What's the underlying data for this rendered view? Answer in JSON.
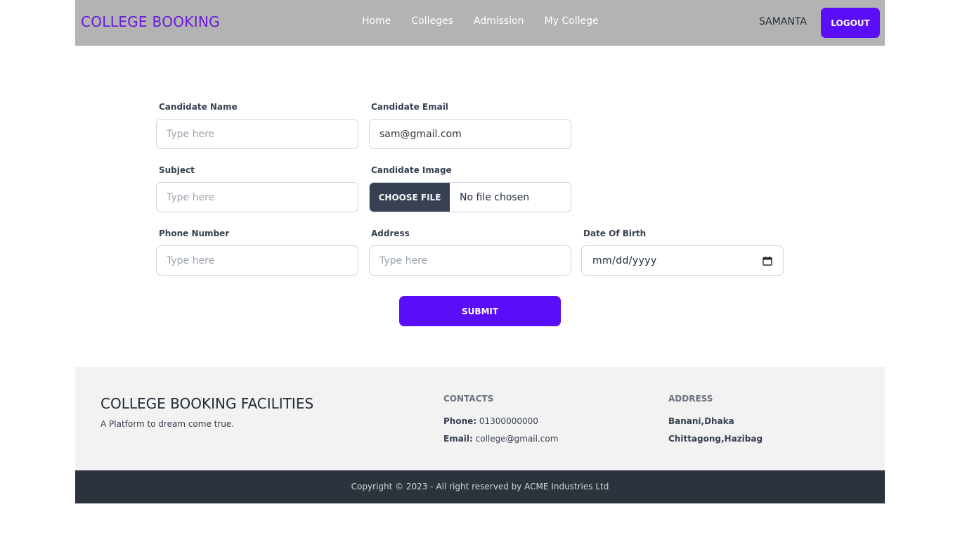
{
  "navbar": {
    "brand": "COLLEGE BOOKING",
    "links": [
      "Home",
      "Colleges",
      "Admission",
      "My College"
    ],
    "user_name": "SAMANTA",
    "logout_label": "LOGOUT"
  },
  "form": {
    "candidate_name": {
      "label": "Candidate Name",
      "placeholder": "Type here",
      "value": ""
    },
    "candidate_email": {
      "label": "Candidate Email",
      "placeholder": "",
      "value": "sam@gmail.com"
    },
    "subject": {
      "label": "Subject",
      "placeholder": "Type here",
      "value": ""
    },
    "candidate_image": {
      "label": "Candidate Image",
      "button_label": "CHOOSE FILE",
      "status": "No file chosen"
    },
    "phone_number": {
      "label": "Phone Number",
      "placeholder": "Type here",
      "value": ""
    },
    "address": {
      "label": "Address",
      "placeholder": "Type here",
      "value": ""
    },
    "date_of_birth": {
      "label": "Date Of Birth",
      "display": "mm/dd/yyyy"
    },
    "submit_label": "SUBMIT"
  },
  "footer": {
    "title": "COLLEGE BOOKING FACILITIES",
    "tagline": "A Platform to dream come true.",
    "contacts": {
      "heading": "CONTACTS",
      "phone_label": "Phone:",
      "phone": "01300000000",
      "email_label": "Email:",
      "email": "college@gmail.com"
    },
    "address": {
      "heading": "ADDRESS",
      "line1": "Banani,Dhaka",
      "line2": "Chittagong,Hazibag"
    },
    "copyright": "Copyright © 2023 - All right reserved by ACME Industries Ltd"
  },
  "colors": {
    "navbar_bg": "#b3b3b3",
    "brand": "#6a1bd6",
    "accent": "#5b0df8",
    "footer_bg": "#f2f2f2",
    "copyright_bg": "#2d333d"
  },
  "icons": {
    "date_picker": "calendar-icon"
  }
}
